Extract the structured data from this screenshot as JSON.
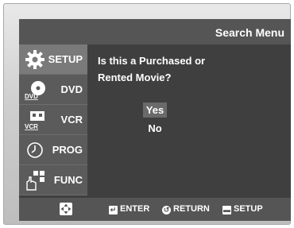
{
  "header": {
    "title": "Search Menu"
  },
  "sidebar": {
    "items": [
      {
        "label": "SETUP",
        "icon": "gear-icon",
        "active": true
      },
      {
        "label": "DVD",
        "icon": "dvd-icon",
        "icon_text": "DVD"
      },
      {
        "label": "VCR",
        "icon": "vcr-icon",
        "icon_text": "VCR"
      },
      {
        "label": "PROG",
        "icon": "clock-icon"
      },
      {
        "label": "FUNC",
        "icon": "hand-icon"
      }
    ]
  },
  "dialog": {
    "question_line1": "Is this a Purchased or",
    "question_line2": "Rented Movie?",
    "options": [
      {
        "label": "Yes",
        "selected": true
      },
      {
        "label": "No",
        "selected": false
      }
    ]
  },
  "footer": {
    "nav_icon": "directional-pad-icon",
    "enter_label": "ENTER",
    "return_label": "RETURN",
    "setup_label": "SETUP"
  },
  "colors": {
    "screen_bg": "#3f3f3f",
    "bar_bg": "#555555",
    "active_item_bg": "#7a7a7a",
    "text": "#ffffff"
  }
}
